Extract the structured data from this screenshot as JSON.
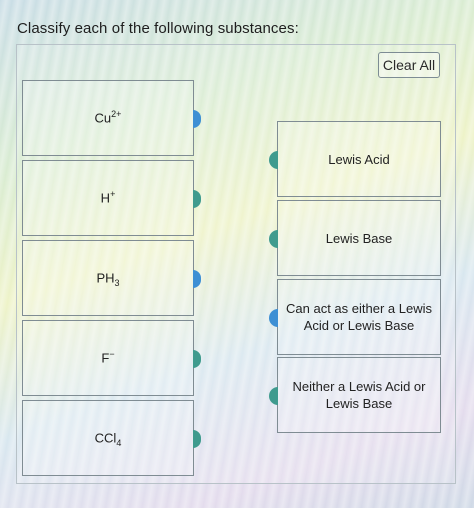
{
  "question": "Classify each of the following substances:",
  "clear_all_label": "Clear All",
  "substances": [
    {
      "base": "Cu",
      "sup": "2+",
      "sub": "",
      "connector_color": "#3d8fd4"
    },
    {
      "base": "H",
      "sup": "+",
      "sub": "",
      "connector_color": "#3f9b8e"
    },
    {
      "base": "PH",
      "sup": "",
      "sub": "3",
      "connector_color": "#3d8fd4"
    },
    {
      "base": "F",
      "sup": "−",
      "sub": "",
      "connector_color": "#3f9b8e"
    },
    {
      "base": "CCl",
      "sup": "",
      "sub": "4",
      "connector_color": "#3f9b8e"
    }
  ],
  "categories": [
    {
      "label": "Lewis Acid",
      "connector_color": "#3f9b8e"
    },
    {
      "label": "Lewis Base",
      "connector_color": "#3f9b8e"
    },
    {
      "label": "Can act as either a Lewis Acid or Lewis Base",
      "connector_color": "#3d8fd4"
    },
    {
      "label": "Neither a Lewis Acid or Lewis Base",
      "connector_color": "#3f9b8e"
    }
  ]
}
